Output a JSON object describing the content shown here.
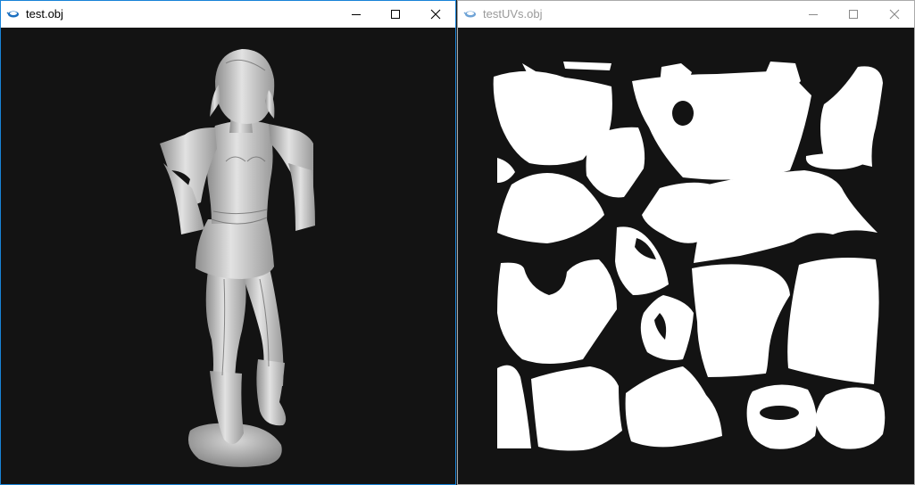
{
  "windows": {
    "left": {
      "title": "test.obj",
      "active": true,
      "icon": "teapot-icon",
      "viewport": "3d-model-render",
      "colors": {
        "background": "#131313",
        "model": "#c8c8c8",
        "border": "#1883d7"
      }
    },
    "right": {
      "title": "testUVs.obj",
      "active": false,
      "icon": "teapot-icon",
      "viewport": "uv-layout-render",
      "colors": {
        "background": "#131313",
        "islands": "#ffffff",
        "border": "#aaaaaa"
      }
    }
  },
  "window_controls": [
    "minimize-icon",
    "maximize-icon",
    "close-icon"
  ]
}
